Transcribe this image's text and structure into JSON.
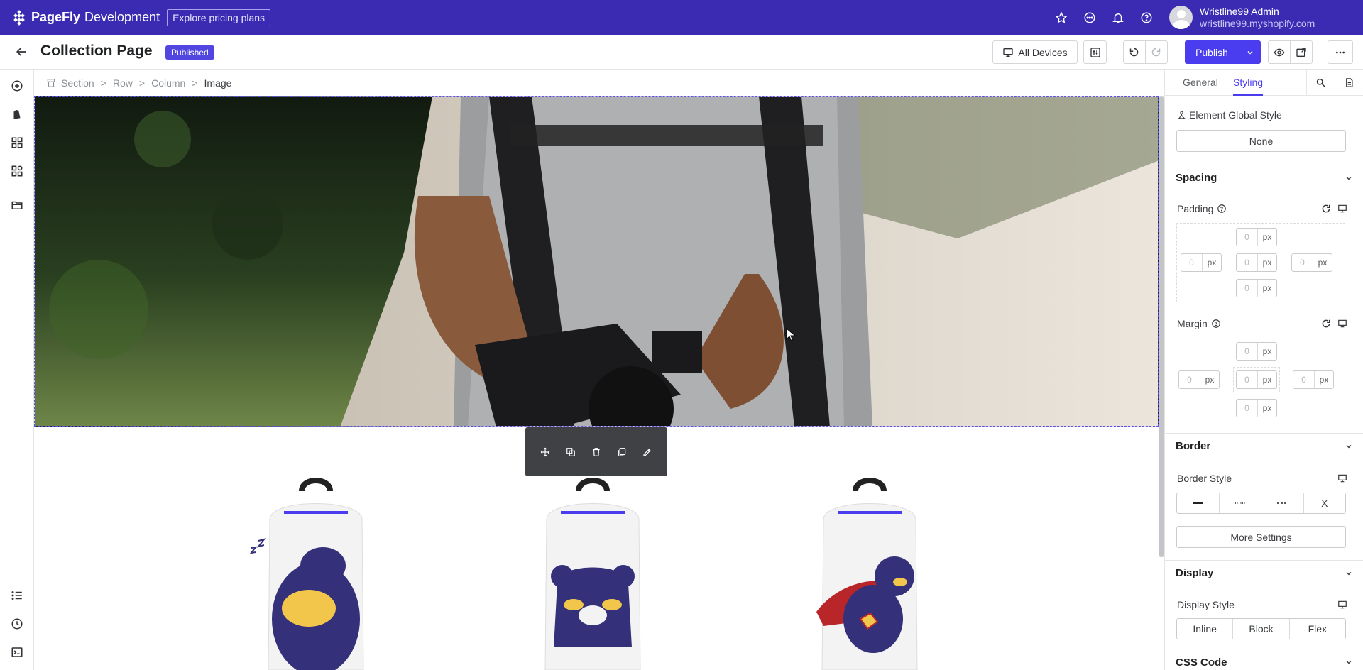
{
  "topbar": {
    "brand": "PageFly",
    "brand_suffix": "Development",
    "pricing_label": "Explore pricing plans",
    "user_name": "Wristline99 Admin",
    "user_email": "wristline99.myshopify.com",
    "bg_color": "#3b2bb3"
  },
  "header": {
    "title": "Collection Page",
    "status_badge": "Published",
    "devices_label": "All Devices",
    "publish_label": "Publish"
  },
  "breadcrumb": [
    "Section",
    "Row",
    "Column",
    "Image"
  ],
  "right_panel": {
    "tabs": [
      "General",
      "Styling"
    ],
    "active_tab": "Styling",
    "global_style_label": "Element Global Style",
    "global_style_value": "None",
    "spacing_title": "Spacing",
    "padding_label": "Padding",
    "padding": {
      "top": "0",
      "left": "0",
      "center": "0",
      "right": "0",
      "bottom": "0",
      "unit": "px"
    },
    "margin_label": "Margin",
    "margin": {
      "top": "0",
      "left": "0",
      "center": "0",
      "right": "0",
      "bottom": "0",
      "unit": "px"
    },
    "border_title": "Border",
    "border_style_label": "Border Style",
    "border_close": "X",
    "more_settings": "More Settings",
    "display_title": "Display",
    "display_style_label": "Display Style",
    "display_options": [
      "Inline",
      "Block",
      "Flex"
    ],
    "css_code_title": "CSS Code"
  },
  "icons": {
    "toolbar": [
      "move-icon",
      "duplicate-icon",
      "delete-icon",
      "copy-icon",
      "eyedropper-icon"
    ],
    "left_rail": [
      "add-icon",
      "shopify-icon",
      "layout-icon",
      "elements-icon",
      "folder-icon",
      "list-icon",
      "history-icon",
      "terminal-icon"
    ]
  },
  "colors": {
    "accent": "#4a3df0",
    "selection": "#5b51e8",
    "backpack_navy": "#34307a",
    "backpack_yellow": "#f2c64b"
  }
}
